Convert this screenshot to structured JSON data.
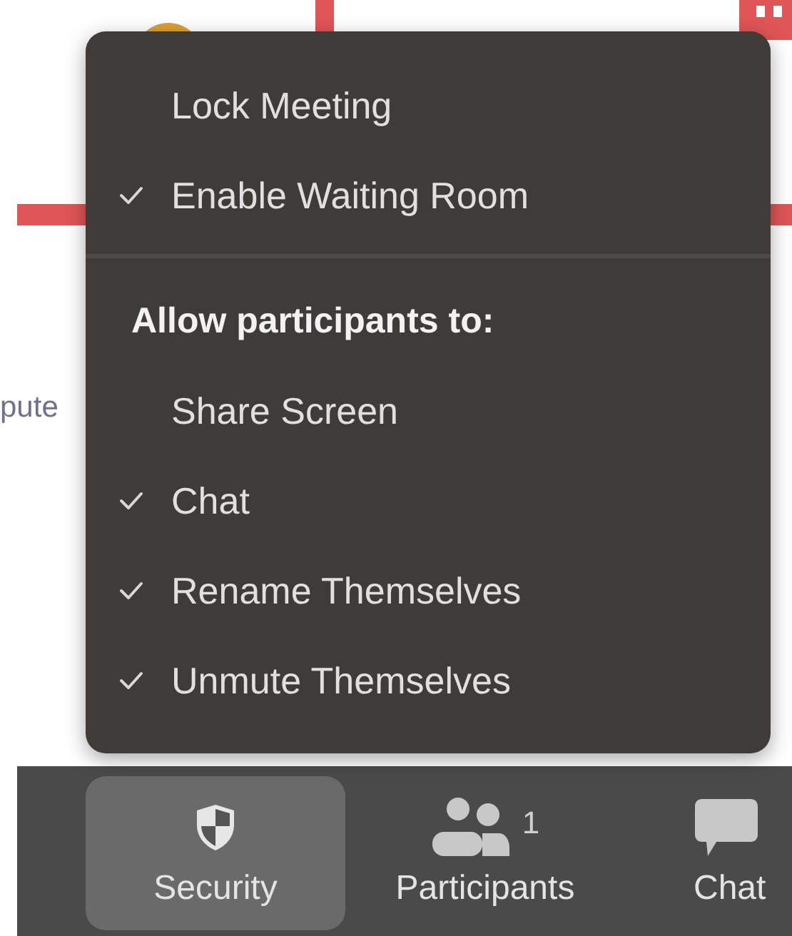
{
  "background": {
    "text": "pute"
  },
  "menu": {
    "items": [
      {
        "kind": "item",
        "label": "Lock Meeting",
        "checked": false
      },
      {
        "kind": "item",
        "label": "Enable Waiting Room",
        "checked": true
      },
      {
        "kind": "separator"
      },
      {
        "kind": "header",
        "label": "Allow participants to:"
      },
      {
        "kind": "item",
        "label": "Share Screen",
        "checked": false
      },
      {
        "kind": "item",
        "label": "Chat",
        "checked": true
      },
      {
        "kind": "item",
        "label": "Rename Themselves",
        "checked": true
      },
      {
        "kind": "item",
        "label": "Unmute Themselves",
        "checked": true
      }
    ]
  },
  "toolbar": {
    "buttons": [
      {
        "kind": "shield",
        "label": "Security",
        "selected": true
      },
      {
        "kind": "people",
        "label": "Participants",
        "badge": "1",
        "selected": false
      },
      {
        "kind": "chat",
        "label": "Chat",
        "selected": false
      }
    ]
  }
}
